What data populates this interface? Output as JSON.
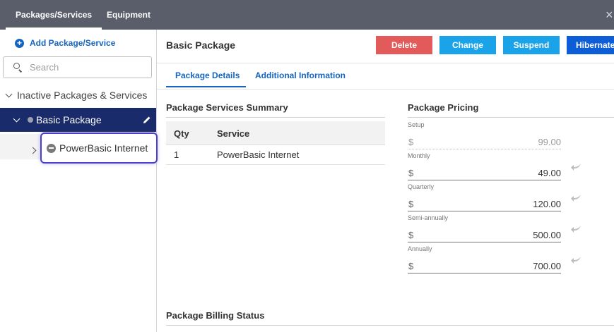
{
  "top_tabs": {
    "packages": "Packages/Services",
    "equipment": "Equipment"
  },
  "close_symbol": "×",
  "sidebar": {
    "add_label": "Add Package/Service",
    "add_symbol": "+",
    "search_placeholder": "Search",
    "group_label": "Inactive Packages & Services",
    "selected_label": "Basic Package",
    "child_label": "PowerBasic Internet"
  },
  "main": {
    "title": "Basic Package",
    "buttons": {
      "delete": "Delete",
      "change": "Change",
      "suspend": "Suspend",
      "hibernate": "Hibernate"
    },
    "tabs": {
      "details": "Package Details",
      "additional": "Additional Information"
    }
  },
  "summary": {
    "title": "Package Services Summary",
    "headers": {
      "qty": "Qty",
      "service": "Service"
    },
    "rows": [
      {
        "qty": "1",
        "service": "PowerBasic Internet"
      }
    ]
  },
  "pricing": {
    "title": "Package Pricing",
    "currency": "$",
    "items": [
      {
        "label": "Setup",
        "value": "99.00"
      },
      {
        "label": "Monthly",
        "value": "49.00"
      },
      {
        "label": "Quarterly",
        "value": "120.00"
      },
      {
        "label": "Semi-annually",
        "value": "500.00"
      },
      {
        "label": "Annually",
        "value": "700.00"
      }
    ]
  },
  "billing": {
    "title": "Package Billing Status"
  },
  "colors": {
    "topbar": "#5a5e6b",
    "selected_row": "#1a2b6b",
    "delete": "#e35a5a",
    "action": "#1aa3e8",
    "hibernate": "#0d5ed6",
    "link": "#1565c0",
    "focus_outline": "#4b3fcf"
  },
  "icons": [
    "close-icon",
    "add-circle-icon",
    "search-icon",
    "chevron-down-icon",
    "chevron-right-icon",
    "status-dot-icon",
    "pencil-icon",
    "minus-circle-icon",
    "undo-arrow-icon"
  ]
}
